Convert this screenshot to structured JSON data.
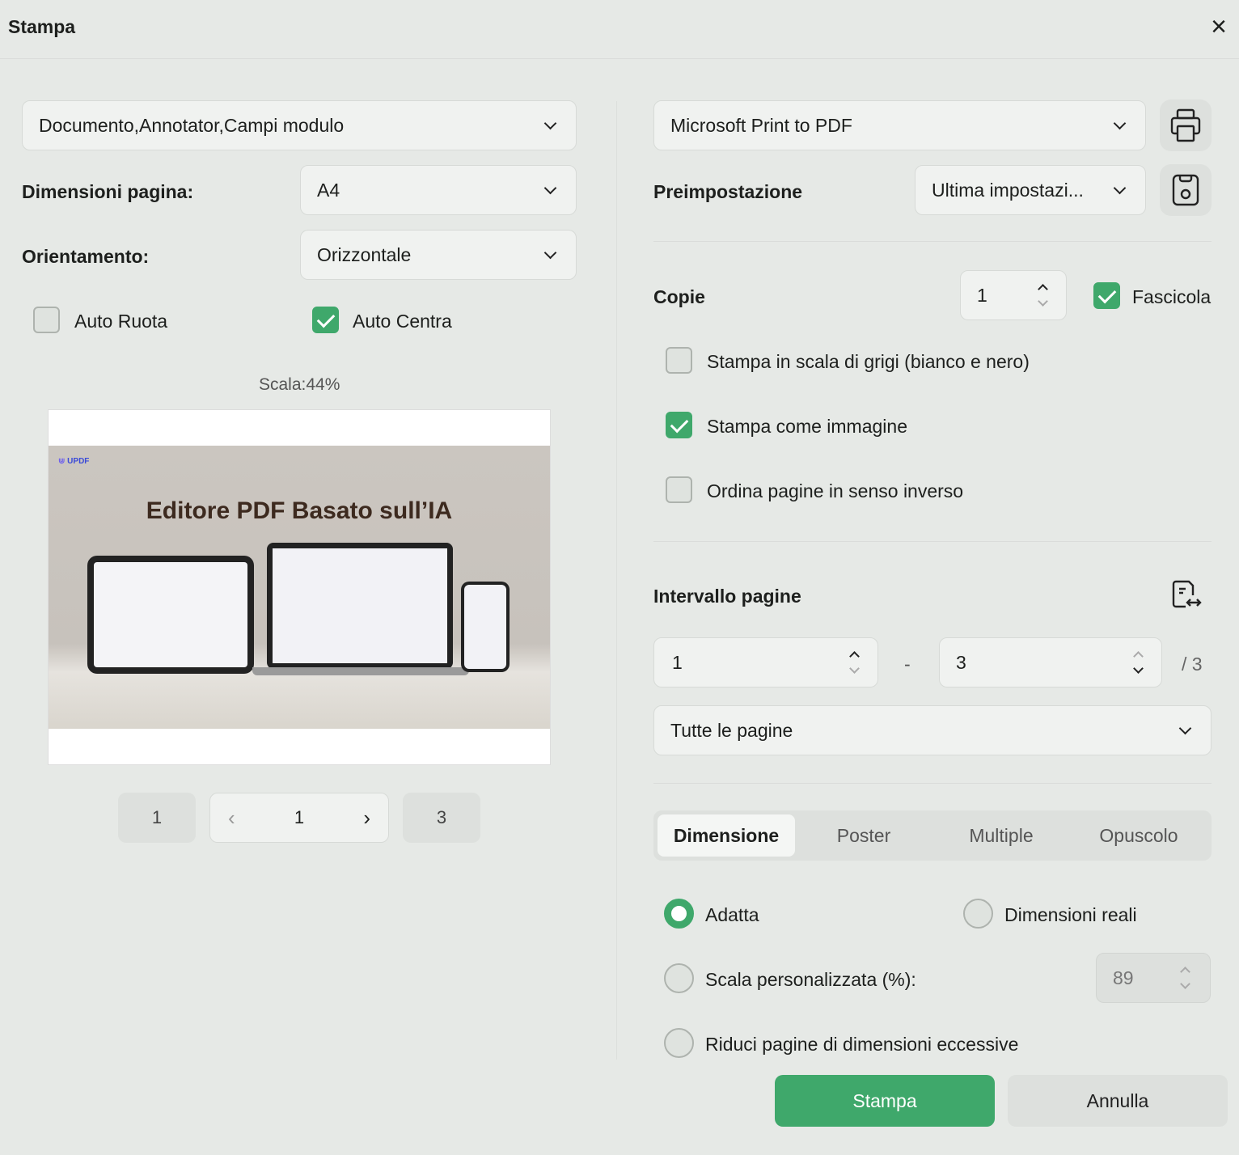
{
  "dialog": {
    "title": "Stampa"
  },
  "left": {
    "content_select": "Documento,Annotator,Campi modulo",
    "page_size_label": "Dimensioni pagina:",
    "page_size_value": "A4",
    "orientation_label": "Orientamento:",
    "orientation_value": "Orizzontale",
    "auto_rotate": {
      "label": "Auto Ruota",
      "checked": false
    },
    "auto_center": {
      "label": "Auto Centra",
      "checked": true
    },
    "scale_text": "Scala:44%",
    "preview": {
      "logo": "UPDF",
      "heading": "Editore PDF Basato sull’IA"
    },
    "pager": {
      "first": "1",
      "current": "1",
      "last": "3"
    }
  },
  "right": {
    "printer": "Microsoft Print to PDF",
    "preset_label": "Preimpostazione",
    "preset_value": "Ultima impostazi...",
    "copies_label": "Copie",
    "copies_value": "1",
    "collate": {
      "label": "Fascicola",
      "checked": true
    },
    "grayscale": {
      "label": "Stampa in scala di grigi (bianco e nero)",
      "checked": false
    },
    "as_image": {
      "label": "Stampa come immagine",
      "checked": true
    },
    "reverse": {
      "label": "Ordina pagine in senso inverso",
      "checked": false
    },
    "range_label": "Intervallo pagine",
    "range_from": "1",
    "range_sep": "-",
    "range_to": "3",
    "range_total": "/ 3",
    "range_select": "Tutte le pagine",
    "tabs": [
      "Dimensione",
      "Poster",
      "Multiple",
      "Opuscolo"
    ],
    "active_tab": "Dimensione",
    "fit": "Adatta",
    "actual_size": "Dimensioni reali",
    "custom_scale": "Scala personalizzata (%):",
    "custom_scale_value": "89",
    "shrink": "Riduci pagine di dimensioni eccessive",
    "selected_option": "Adatta"
  },
  "footer": {
    "print": "Stampa",
    "cancel": "Annulla"
  },
  "colors": {
    "accent": "#3fa86b",
    "background": "#e6e9e6"
  }
}
